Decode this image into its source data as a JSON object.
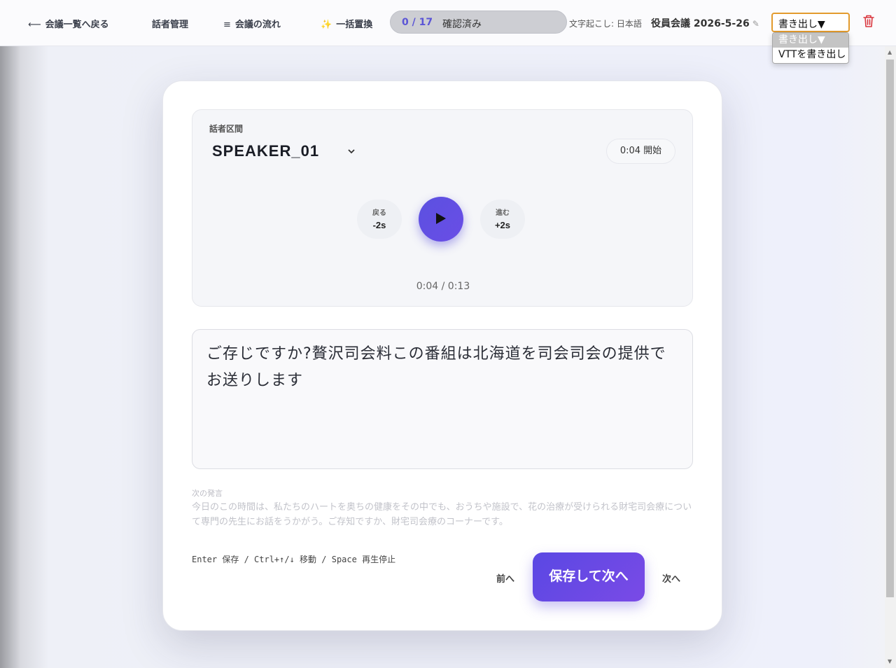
{
  "topbar": {
    "back": {
      "icon": "⟵",
      "label": "会議一覧へ戻る"
    },
    "speaker_mgmt": "話者管理",
    "flow": {
      "icon": "≡",
      "label": "会議の流れ"
    },
    "bulk": {
      "icon": "✨",
      "label": "一括置換"
    },
    "progress": {
      "count": "0 / 17",
      "label": "確認済み"
    },
    "transcription_lang": "文字起こし: 日本語",
    "meeting_title": "役員会議 2026-5-26",
    "edit_icon": "✎",
    "export": {
      "value": "書き出し▼",
      "options": [
        "書き出し▼",
        "VTTを書き出し"
      ]
    },
    "delete_icon": "trash-icon"
  },
  "segment": {
    "label": "話者区間",
    "speaker": "SPEAKER_01",
    "chevron": "⌄",
    "start": "0:04 開始",
    "back": {
      "top": "戻る",
      "bottom": "-2s"
    },
    "forward": {
      "top": "進む",
      "bottom": "+2s"
    },
    "time": "0:04 / 0:13"
  },
  "editor": {
    "text": "ご存じですか?贅沢司会料この番組は北海道を司会司会の提供でお送りします"
  },
  "next_utterance": {
    "label": "次の発言",
    "text": "今日のこの時間は、私たちのハートを奥ちの健康をその中でも、おうちや施設で、花の治療が受けられる財宅司会療について専門の先生にお話をうかがう。ご存知ですか、財宅司会療のコーナーです。"
  },
  "footer": {
    "shortcuts": "Enter 保存 / Ctrl+↑/↓ 移動 / Space 再生停止",
    "prev": "前へ",
    "save_next": "保存して次へ",
    "next": "次へ"
  },
  "colors": {
    "accent": "#5b50e0",
    "export_border": "#e39b2d",
    "trash": "#d9363e"
  }
}
